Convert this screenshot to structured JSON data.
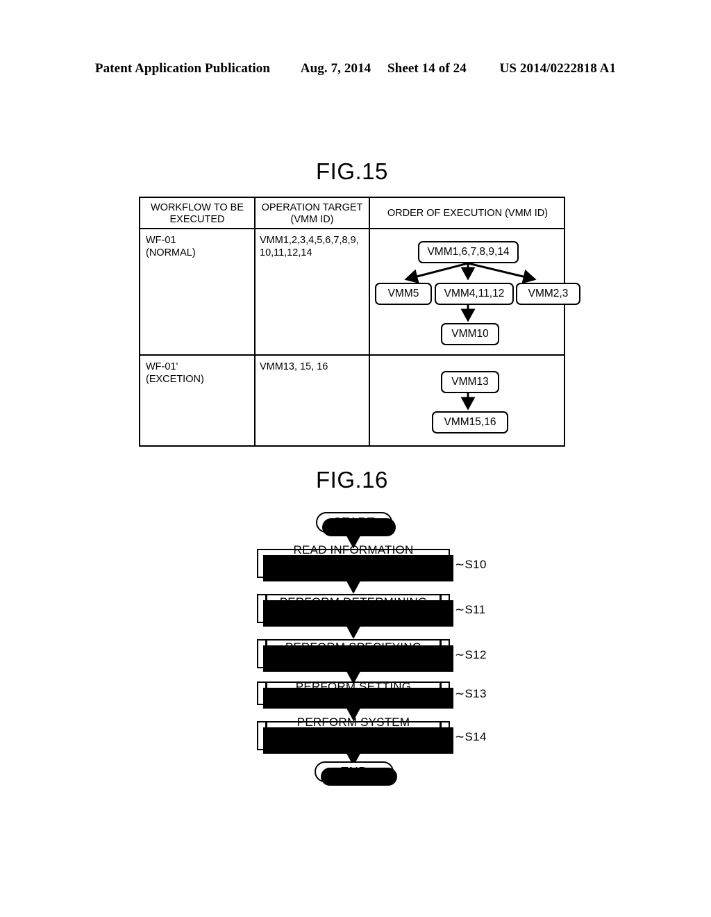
{
  "header": {
    "publication": "Patent Application Publication",
    "date": "Aug. 7, 2014",
    "sheet": "Sheet 14 of 24",
    "doc_number": "US 2014/0222818 A1"
  },
  "fig15": {
    "title": "FIG.15",
    "columns": [
      "WORKFLOW TO BE\nEXECUTED",
      "OPERATION TARGET\n(VMM ID)",
      "ORDER OF EXECUTION (VMM ID)"
    ],
    "rows": [
      {
        "workflow": "WF-01\n(NORMAL)",
        "operation_target": "VMM1,2,3,4,5,6,7,8,9,\n10,11,12,14",
        "order_of_execution": {
          "nodes": [
            {
              "id": "n1",
              "label": "VMM1,6,7,8,9,14"
            },
            {
              "id": "n2",
              "label": "VMM5"
            },
            {
              "id": "n3",
              "label": "VMM4,11,12"
            },
            {
              "id": "n4",
              "label": "VMM2,3"
            },
            {
              "id": "n5",
              "label": "VMM10"
            }
          ],
          "edges": [
            {
              "from": "n1",
              "to": "n2"
            },
            {
              "from": "n1",
              "to": "n3"
            },
            {
              "from": "n1",
              "to": "n4"
            },
            {
              "from": "n3",
              "to": "n5"
            }
          ]
        }
      },
      {
        "workflow": "WF-01'\n(EXCETION)",
        "operation_target": "VMM13, 15, 16",
        "order_of_execution": {
          "nodes": [
            {
              "id": "m1",
              "label": "VMM13"
            },
            {
              "id": "m2",
              "label": "VMM15,16"
            }
          ],
          "edges": [
            {
              "from": "m1",
              "to": "m2"
            }
          ]
        }
      }
    ]
  },
  "fig16": {
    "title": "FIG.16",
    "start_label": "START",
    "end_label": "END",
    "steps": [
      {
        "id": "S10",
        "label": "READ INFORMATION RELATED TO\nCOMPONENT",
        "shape": "process"
      },
      {
        "id": "S11",
        "label": "PERFORM DETERMINING\nPROCESS",
        "shape": "predefined-process"
      },
      {
        "id": "S12",
        "label": "PERFORM SPECIFYING\nPROCESS",
        "shape": "predefined-process"
      },
      {
        "id": "S13",
        "label": "PERFORM SETTING PROCESS",
        "shape": "predefined-process"
      },
      {
        "id": "S14",
        "label": "PERFORM SYSTEM UPDATE\nPROCESS",
        "shape": "predefined-process"
      }
    ]
  },
  "colors": {
    "ink": "#000000",
    "paper": "#ffffff"
  }
}
